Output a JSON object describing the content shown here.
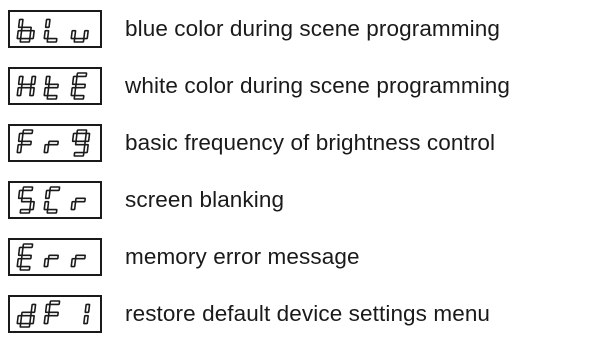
{
  "legend": {
    "rows": [
      {
        "code": "bLu",
        "description": "blue color during scene programming"
      },
      {
        "code": "HtE",
        "description": "white color during scene programming"
      },
      {
        "code": "Fr9",
        "description": "basic frequency of brightness control"
      },
      {
        "code": "5Cr",
        "description": "screen blanking"
      },
      {
        "code": "Err",
        "description": "memory error message"
      },
      {
        "code": "dF1",
        "description": "restore default device settings menu"
      }
    ],
    "segment_color": "#1a1a1a"
  }
}
